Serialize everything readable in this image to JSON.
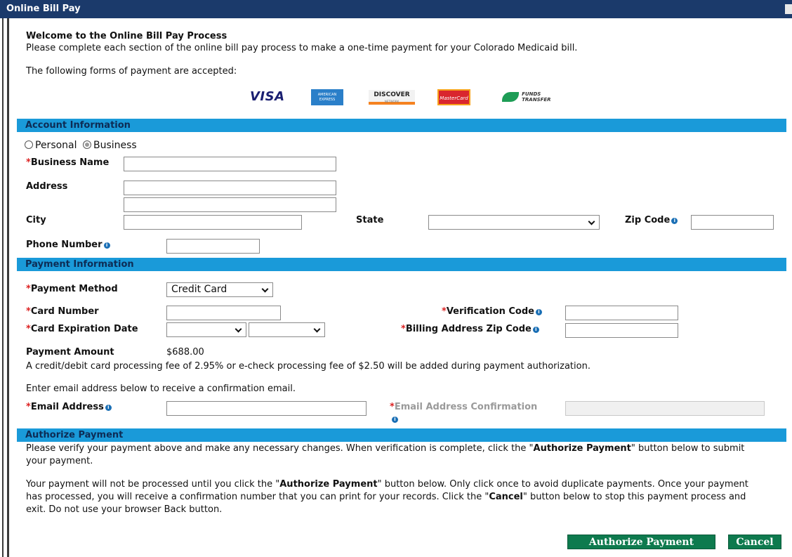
{
  "window": {
    "title": "Online Bill Pay"
  },
  "intro": {
    "heading": "Welcome to the Online Bill Pay Process",
    "description": "Please complete each section of the online bill pay process to make a one-time payment for your Colorado Medicaid bill.",
    "accepted_label": "The following forms of payment are accepted:",
    "logos": [
      {
        "name": "visa-logo",
        "text": "VISA"
      },
      {
        "name": "amex-logo",
        "text": "AMERICAN EXPRESS"
      },
      {
        "name": "discover-logo",
        "text": "DISCOVER",
        "sub": "NETWORK"
      },
      {
        "name": "mastercard-logo",
        "text": "MasterCard"
      },
      {
        "name": "funds-transfer-logo",
        "line1": "FUNDS",
        "line2": "TRANSFER"
      }
    ]
  },
  "account": {
    "section_title": "Account Information",
    "type_options": [
      {
        "label": "Personal",
        "selected": false
      },
      {
        "label": "Business",
        "selected": true
      }
    ],
    "business_name_label": "Business Name",
    "address_label": "Address",
    "city_label": "City",
    "state_label": "State",
    "state_value": "",
    "zip_label": "Zip Code",
    "phone_label": "Phone Number"
  },
  "payment": {
    "section_title": "Payment Information",
    "method_label": "Payment Method",
    "method_value": "Credit Card",
    "card_number_label": "Card Number",
    "verification_label": "Verification Code",
    "expiration_label": "Card Expiration Date",
    "expiration_month": "",
    "expiration_year": "",
    "billing_zip_label": "Billing Address Zip Code",
    "amount_label": "Payment Amount",
    "amount_value": "$688.00",
    "fee_notice": "A credit/debit card processing fee of 2.95% or e-check processing fee of $2.50 will be added during payment authorization.",
    "email_prompt": "Enter email address below to receive a confirmation email.",
    "email_label": "Email Address",
    "email_confirm_label": "Email Address Confirmation"
  },
  "authorize": {
    "section_title": "Authorize Payment",
    "para1_a": "Please verify your payment above and make any necessary changes.  When verification is complete, click the \"",
    "para1_b": "Authorize Payment",
    "para1_c": "\" button below to submit your payment.",
    "para2_a": "Your payment will not be processed until you click the \"",
    "para2_b": "Authorize Payment",
    "para2_c": "\" button below.  Only click once to avoid duplicate payments.  Once your payment has processed, you will receive a confirmation number that you can print for your records.  Click the \"",
    "para2_d": "Cancel",
    "para2_e": "\" button below to stop this payment process and exit.  Do not use your browser Back button.",
    "authorize_button": "Authorize Payment",
    "cancel_button": "Cancel"
  },
  "colors": {
    "title_bar": "#1b3a6b",
    "section_bar": "#1a9ad9",
    "button": "#0e7a4e",
    "required": "#d22222",
    "info_icon": "#1a6fb5"
  }
}
